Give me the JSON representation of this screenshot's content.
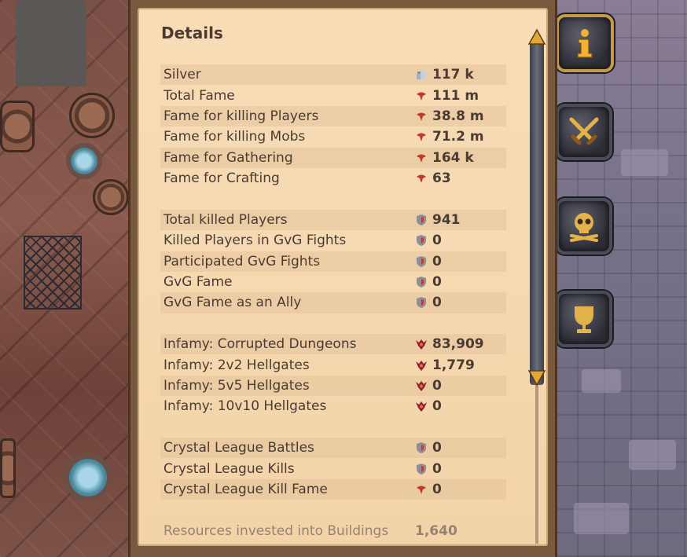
{
  "panel": {
    "title": "Details"
  },
  "rows": [
    {
      "label": "Silver",
      "value": "117 k",
      "icon": "silver-icon"
    },
    {
      "label": "Total Fame",
      "value": "111 m",
      "icon": "fame-icon"
    },
    {
      "label": "Fame for killing Players",
      "value": "38.8 m",
      "icon": "fame-icon"
    },
    {
      "label": "Fame for killing Mobs",
      "value": "71.2 m",
      "icon": "fame-icon"
    },
    {
      "label": "Fame for Gathering",
      "value": "164 k",
      "icon": "fame-icon"
    },
    {
      "label": "Fame for Crafting",
      "value": "63",
      "icon": "fame-icon"
    },
    {
      "label": "Total killed Players",
      "value": "941",
      "icon": "shield-icon"
    },
    {
      "label": "Killed Players in GvG Fights",
      "value": "0",
      "icon": "shield-icon"
    },
    {
      "label": "Participated GvG Fights",
      "value": "0",
      "icon": "shield-icon"
    },
    {
      "label": "GvG Fame",
      "value": "0",
      "icon": "shield-icon"
    },
    {
      "label": "GvG Fame as an Ally",
      "value": "0",
      "icon": "shield-icon"
    },
    {
      "label": "Infamy: Corrupted Dungeons",
      "value": "83,909",
      "icon": "infamy-icon"
    },
    {
      "label": "Infamy: 2v2 Hellgates",
      "value": "1,779",
      "icon": "infamy-icon"
    },
    {
      "label": "Infamy: 5v5 Hellgates",
      "value": "0",
      "icon": "infamy-icon"
    },
    {
      "label": "Infamy: 10v10 Hellgates",
      "value": "0",
      "icon": "infamy-icon"
    },
    {
      "label": "Crystal League Battles",
      "value": "0",
      "icon": "shield-icon"
    },
    {
      "label": "Crystal League Kills",
      "value": "0",
      "icon": "shield-icon"
    },
    {
      "label": "Crystal League Kill Fame",
      "value": "0",
      "icon": "fame-icon"
    },
    {
      "label": "Resources invested into Buildings",
      "value": "1,640",
      "icon": ""
    }
  ],
  "side_buttons": [
    {
      "name": "info-button",
      "icon": "info-icon",
      "active": true
    },
    {
      "name": "combat-button",
      "icon": "crossed-swords-icon",
      "active": false
    },
    {
      "name": "deaths-button",
      "icon": "skull-crossbones-icon",
      "active": false
    },
    {
      "name": "achievements-button",
      "icon": "trophy-icon",
      "active": false
    }
  ],
  "colors": {
    "gold": "#f2b233",
    "fame_red": "#c0392b",
    "text": "#4a3b33"
  }
}
